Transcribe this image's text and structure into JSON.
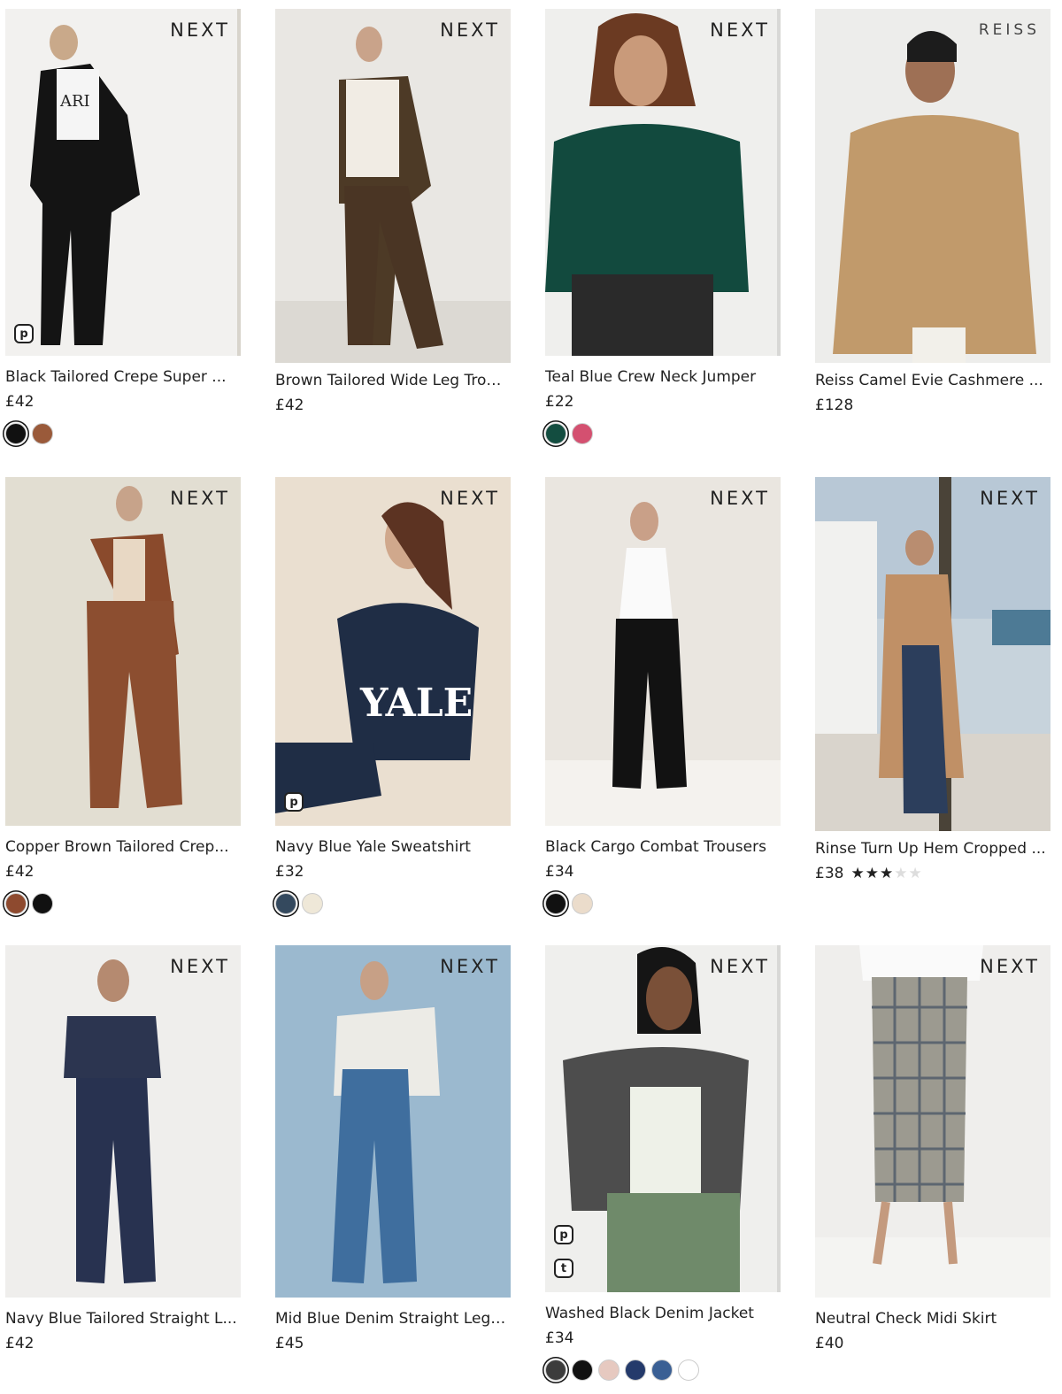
{
  "products": [
    {
      "brand": "NEXT",
      "title": "Black Tailored Crepe Super ...",
      "price": "£42",
      "swatches": [
        "#111111",
        "#9a5a3a"
      ]
    },
    {
      "brand": "NEXT",
      "title": "Brown Tailored Wide Leg Trou...",
      "price": "£42",
      "swatches": []
    },
    {
      "brand": "NEXT",
      "title": "Teal Blue Crew Neck Jumper",
      "price": "£22",
      "swatches": [
        "#134d40",
        "#d45070"
      ]
    },
    {
      "brand": "REISS",
      "title": "Reiss Camel Evie Cashmere ...",
      "price": "£128",
      "swatches": []
    },
    {
      "brand": "NEXT",
      "title": "Copper Brown Tailored Crep...",
      "price": "£42",
      "swatches": [
        "#8e4a2f",
        "#111111"
      ]
    },
    {
      "brand": "NEXT",
      "title": "Navy Blue Yale Sweatshirt",
      "price": "£32",
      "swatches": [
        "#34495e",
        "#efe8d8"
      ]
    },
    {
      "brand": "NEXT",
      "title": "Black Cargo Combat Trousers",
      "price": "£34",
      "swatches": [
        "#111111",
        "#ebdccb"
      ]
    },
    {
      "brand": "NEXT",
      "title": "Rinse Turn Up Hem Cropped ...",
      "price": "£38",
      "rating": 3,
      "rating_max": 5,
      "swatches": []
    },
    {
      "brand": "NEXT",
      "title": "Navy Blue Tailored Straight L...",
      "price": "£42",
      "swatches": []
    },
    {
      "brand": "NEXT",
      "title": "Mid Blue Denim Straight Leg ...",
      "price": "£45",
      "swatches": []
    },
    {
      "brand": "NEXT",
      "title": "Washed Black Denim Jacket",
      "price": "£34",
      "swatches": [
        "#3c3c3c",
        "#111111",
        "#e6c9c0",
        "#243a6b",
        "#3a5f94",
        "#ffffff"
      ]
    },
    {
      "brand": "NEXT",
      "title": "Neutral Check Midi Skirt",
      "price": "£40",
      "swatches": []
    }
  ]
}
